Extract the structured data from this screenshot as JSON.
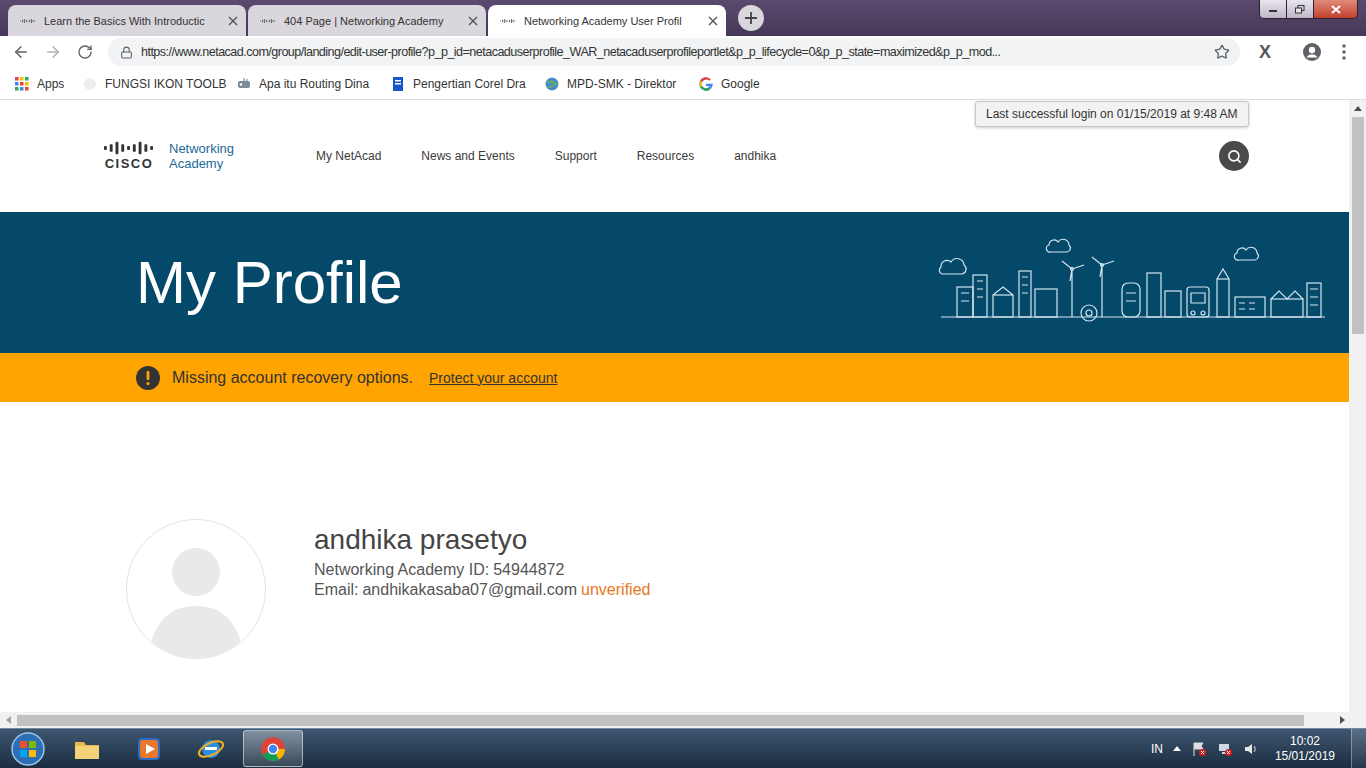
{
  "tabs": [
    {
      "label": "Learn the Basics With Introductic",
      "selected": false
    },
    {
      "label": "404 Page | Networking Academy",
      "selected": false
    },
    {
      "label": "Networking Academy User Profil",
      "selected": true
    }
  ],
  "address_bar": {
    "url": "https://www.netacad.com/group/landing/edit-user-profile?p_p_id=netacaduserprofile_WAR_netacaduserprofileportlet&p_p_lifecycle=0&p_p_state=maximized&p_p_mod...",
    "bookmarked": false
  },
  "extension": {
    "label": "X"
  },
  "bookmarks": [
    {
      "label": "Apps",
      "kind": "apps"
    },
    {
      "label": "FUNGSI IKON TOOLB",
      "kind": "page"
    },
    {
      "label": "Apa itu Routing Dina",
      "kind": "routing"
    },
    {
      "label": "Pengertian Corel Dra",
      "kind": "doc"
    },
    {
      "label": "MPD-SMK - Direktor",
      "kind": "globe"
    },
    {
      "label": "Google",
      "kind": "google"
    }
  ],
  "tooltip": "Last successful login on 01/15/2019 at 9:48 AM",
  "site": {
    "logo_mark": "CISCO",
    "logo_line1": "Networking",
    "logo_line2": "Academy",
    "nav": [
      "My NetAcad",
      "News and Events",
      "Support",
      "Resources",
      "andhika"
    ]
  },
  "banner": {
    "title": "My Profile"
  },
  "alert": {
    "message": "Missing account recovery options.",
    "link": "Protect your account"
  },
  "profile": {
    "name": "andhika prasetyo",
    "id_label": "Networking Academy ID:",
    "id": "54944872",
    "email_label": "Email:",
    "email": "andhikakasaba07@gmail.com",
    "email_status": "unverified"
  },
  "taskbar": {
    "apps": [
      {
        "kind": "explorer",
        "selected": false
      },
      {
        "kind": "media",
        "selected": false
      },
      {
        "kind": "ie",
        "selected": false
      },
      {
        "kind": "chrome",
        "selected": true
      }
    ],
    "language": "IN",
    "time": "10:02",
    "date": "15/01/2019"
  }
}
